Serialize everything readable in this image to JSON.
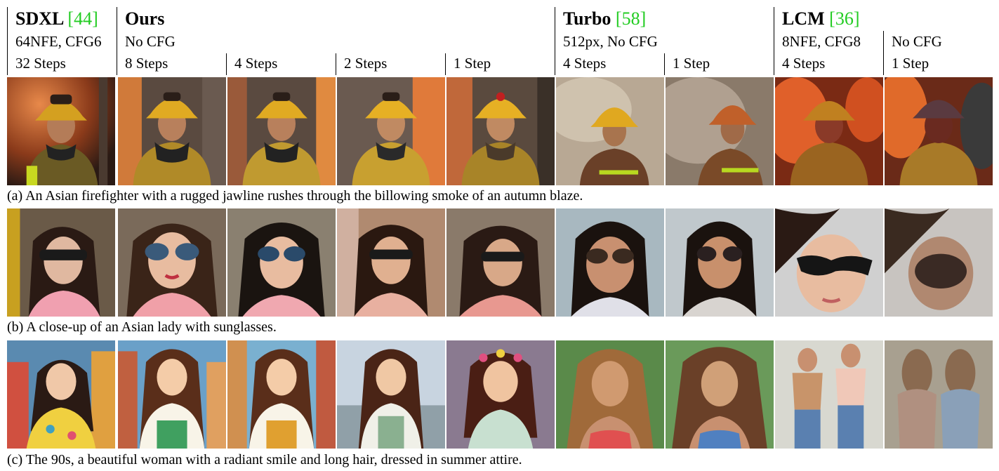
{
  "groups": {
    "sdxl": {
      "name": "SDXL",
      "ref": "[44]",
      "setting": "64NFE, CFG6",
      "steps": [
        "32 Steps"
      ]
    },
    "ours": {
      "name": "Ours",
      "ref": "",
      "setting": "No CFG",
      "steps": [
        "8 Steps",
        "4 Steps",
        "2 Steps",
        "1 Step"
      ]
    },
    "turbo": {
      "name": "Turbo",
      "ref": "[58]",
      "setting": "512px, No CFG",
      "steps": [
        "4 Steps",
        "1 Step"
      ]
    },
    "lcm": {
      "name": "LCM",
      "ref": "[36]",
      "settings": [
        "8NFE, CFG8",
        "No CFG"
      ],
      "steps": [
        "4 Steps",
        "1 Step"
      ]
    }
  },
  "rows": [
    {
      "caption": "(a) An Asian firefighter with a rugged jawline rushes through the billowing smoke of an autumn blaze.",
      "subject": "firefighter"
    },
    {
      "caption": "(b) A close-up of an Asian lady with sunglasses.",
      "subject": "lady-sunglasses"
    },
    {
      "caption": "(c) The 90s, a beautiful woman with a radiant smile and long hair, dressed in summer attire.",
      "subject": "summer-woman"
    }
  ],
  "colors": {
    "reference": "#22cc22"
  }
}
